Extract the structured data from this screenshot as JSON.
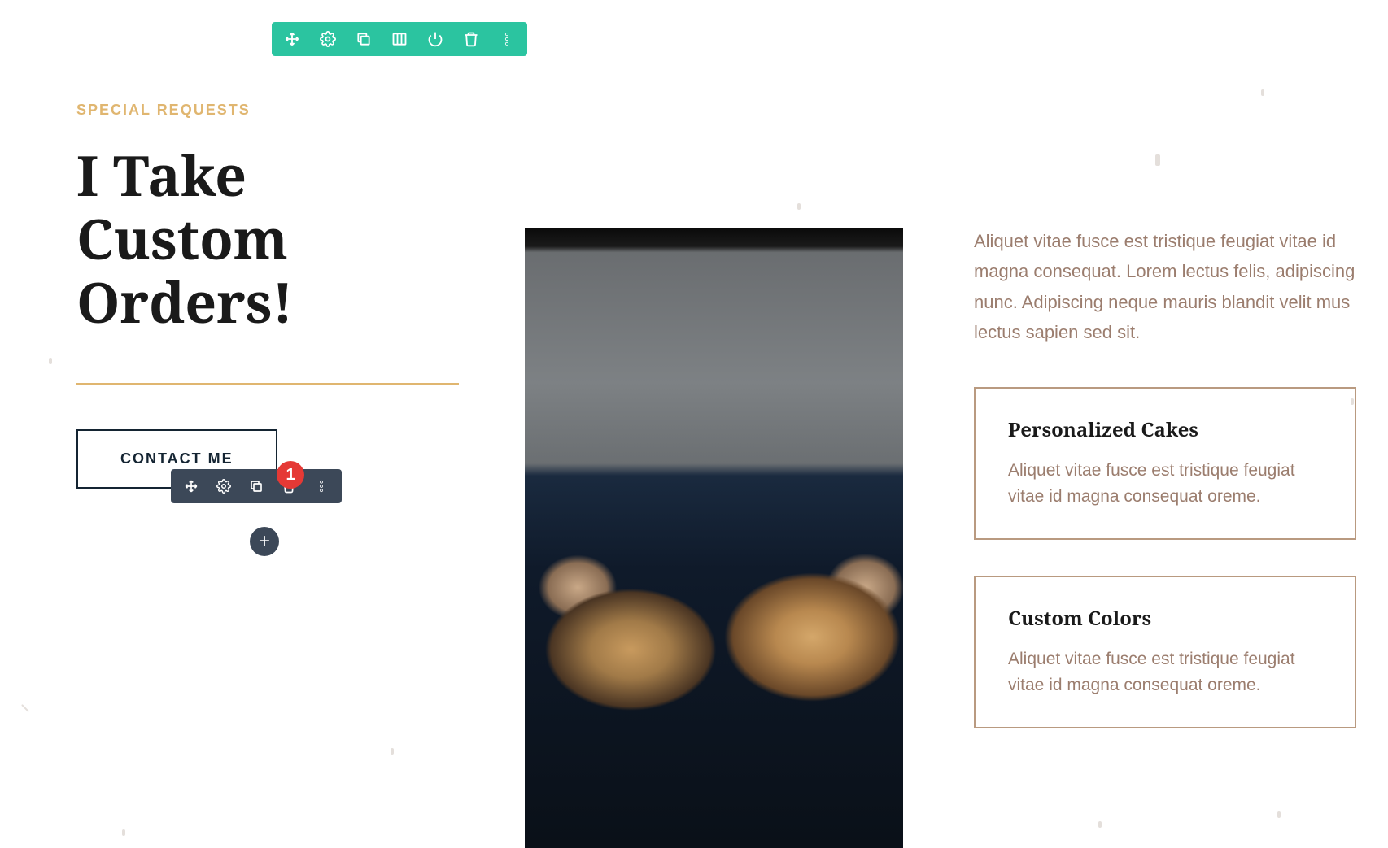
{
  "section_toolbar": {
    "icons": [
      "move-icon",
      "settings-icon",
      "duplicate-icon",
      "columns-icon",
      "power-icon",
      "delete-icon",
      "more-icon"
    ]
  },
  "module_toolbar": {
    "icons": [
      "move-icon",
      "settings-icon",
      "duplicate-icon",
      "delete-icon",
      "more-icon"
    ],
    "badge": "1",
    "add_label": "+"
  },
  "left": {
    "eyebrow": "SPECIAL REQUESTS",
    "headline": "I Take Custom Orders!",
    "button_label": "CONTACT ME"
  },
  "right": {
    "intro": "Aliquet vitae fusce est tristique feugiat vitae id magna consequat. Lorem lectus felis, adipiscing nunc. Adipiscing neque mauris blandit velit mus lectus sapien sed sit.",
    "cards": [
      {
        "title": "Personalized Cakes",
        "body": "Aliquet vitae fusce est tristique feugiat vitae id magna consequat oreme."
      },
      {
        "title": "Custom Colors",
        "body": "Aliquet vitae fusce est tristique feugiat vitae id magna consequat oreme."
      }
    ]
  },
  "colors": {
    "accent": "#e0b670",
    "teal": "#2bc4a0",
    "dark": "#3c4858",
    "badge": "#e53935"
  }
}
